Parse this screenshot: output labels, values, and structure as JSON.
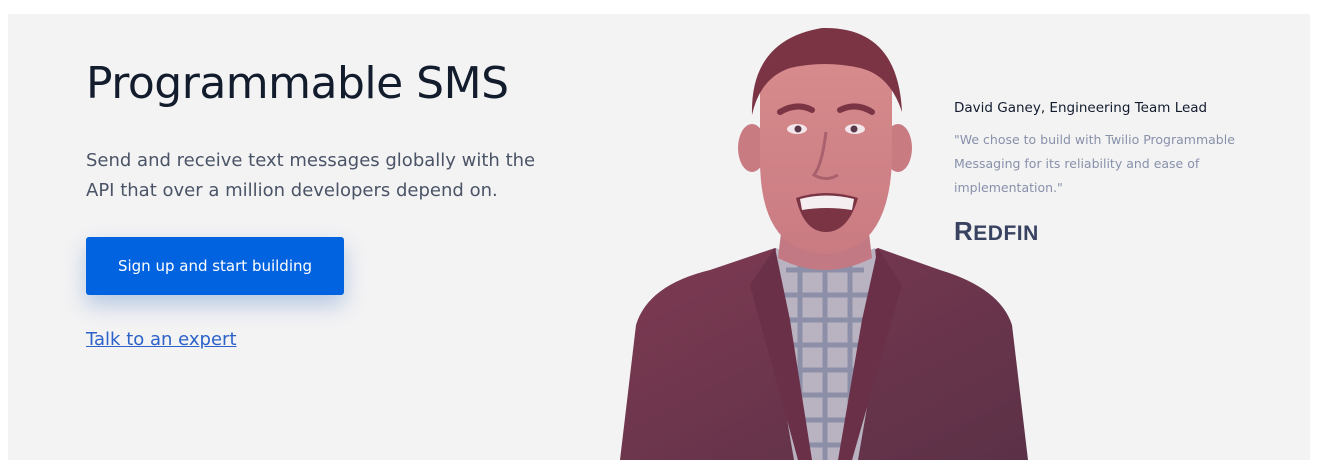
{
  "hero": {
    "title": "Programmable SMS",
    "subtitle": "Send and receive text messages globally with the API that over a million developers depend on.",
    "cta_label": "Sign up and start building",
    "secondary_link": "Talk to an expert"
  },
  "testimonial": {
    "name": "David Ganey, Engineering Team Lead",
    "quote": "\"We chose to build with Twilio Programmable Messaging for its reliability and ease of implementation.\"",
    "company_logo_text": "REDFIN"
  },
  "colors": {
    "background": "#f3f3f4",
    "heading": "#121c2d",
    "button": "#0263e0",
    "link": "#2c62c9",
    "portrait_tint": "#8c4358"
  }
}
